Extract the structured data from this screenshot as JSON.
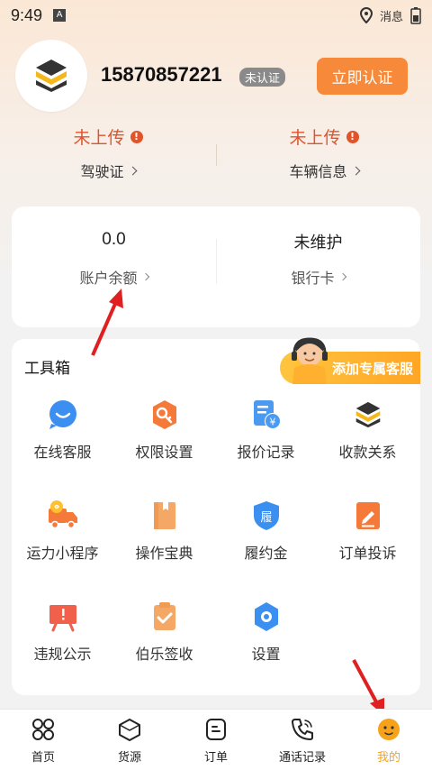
{
  "status_bar": {
    "time": "9:49",
    "network_text": "消息"
  },
  "profile": {
    "phone": "15870857221",
    "verify_badge": "未认证",
    "verify_button": "立即认证"
  },
  "uploads": [
    {
      "status": "未上传",
      "label": "驾驶证"
    },
    {
      "status": "未上传",
      "label": "车辆信息"
    }
  ],
  "account": {
    "balance_value": "0.0",
    "balance_label": "账户余额",
    "bank_value": "未维护",
    "bank_label": "银行卡"
  },
  "tools": {
    "title": "工具箱",
    "cs_banner": "添加专属客服",
    "items": [
      {
        "label": "在线客服",
        "icon": "chat-bubble-icon"
      },
      {
        "label": "权限设置",
        "icon": "key-icon"
      },
      {
        "label": "报价记录",
        "icon": "quote-doc-icon"
      },
      {
        "label": "收款关系",
        "icon": "logo-icon"
      },
      {
        "label": "运力小程序",
        "icon": "truck-icon"
      },
      {
        "label": "操作宝典",
        "icon": "book-icon"
      },
      {
        "label": "履约金",
        "icon": "shield-icon"
      },
      {
        "label": "订单投诉",
        "icon": "edit-icon"
      },
      {
        "label": "违规公示",
        "icon": "alert-board-icon"
      },
      {
        "label": "伯乐签收",
        "icon": "clipboard-check-icon"
      },
      {
        "label": "设置",
        "icon": "gear-icon"
      }
    ]
  },
  "nav": [
    {
      "label": "首页",
      "icon": "home-grid-icon"
    },
    {
      "label": "货源",
      "icon": "cargo-box-icon"
    },
    {
      "label": "订单",
      "icon": "order-icon"
    },
    {
      "label": "通话记录",
      "icon": "phone-icon"
    },
    {
      "label": "我的",
      "icon": "profile-face-icon",
      "active": true
    }
  ],
  "colors": {
    "accent": "#f7893a",
    "warning": "#e0532b",
    "active_nav": "#f7a21b"
  }
}
